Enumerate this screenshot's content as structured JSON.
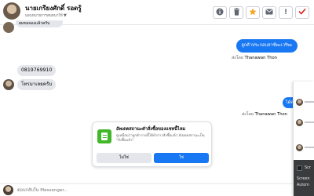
{
  "header": {
    "name": "นายเกรียงศักดิ์ รอดรู้",
    "subtitle": "มอบหมายการสนทนาให้",
    "buttons": [
      {
        "name": "info-button",
        "icon": "info-icon"
      },
      {
        "name": "trash-button",
        "icon": "trash-icon"
      },
      {
        "name": "star-button",
        "icon": "star-icon",
        "color": "#f5a623"
      },
      {
        "name": "mail-button",
        "icon": "mail-icon"
      },
      {
        "name": "flag-button",
        "icon": "exclamation-icon"
      },
      {
        "name": "done-button",
        "icon": "check-icon",
        "color": "#e02020"
      }
    ]
  },
  "messages": {
    "top_clip": "ผมขอจองแล้วครับ",
    "outgoing_1": "ลูกค้าประกอบสาซ์พะเวริพะ",
    "sent_by_label": "ส่งโดย",
    "sent_by_name": "Thanawan Thon",
    "incoming_phone": "0819769910",
    "incoming_2": "โทรมาเลยครับ",
    "outgoing_2": "ได้ค่ะ"
  },
  "survey_card": {
    "title": "อัพเดตสถานะคำสั่งซื้อของแชทนี้ไหม",
    "body": "ดูเหมือนว่าลูกค้ารายนี้ได้ทำการสั่งซื้อแล้ว อัปเดตสถานะเป็น \"สั่งซื้อแล้ว\"",
    "no_label": "ไม่ใช่",
    "yes_label": "ใช่",
    "icon": "document-icon",
    "accent": "#42b72a"
  },
  "composer": {
    "placeholder": "ตอบกลับใน Messenger..."
  },
  "side_panel": {
    "item_1": "Scr",
    "item_2": "Screen",
    "item_3": "Autom"
  },
  "colors": {
    "brand_blue": "#1877f2",
    "bubble_gray": "#e4e6eb"
  }
}
